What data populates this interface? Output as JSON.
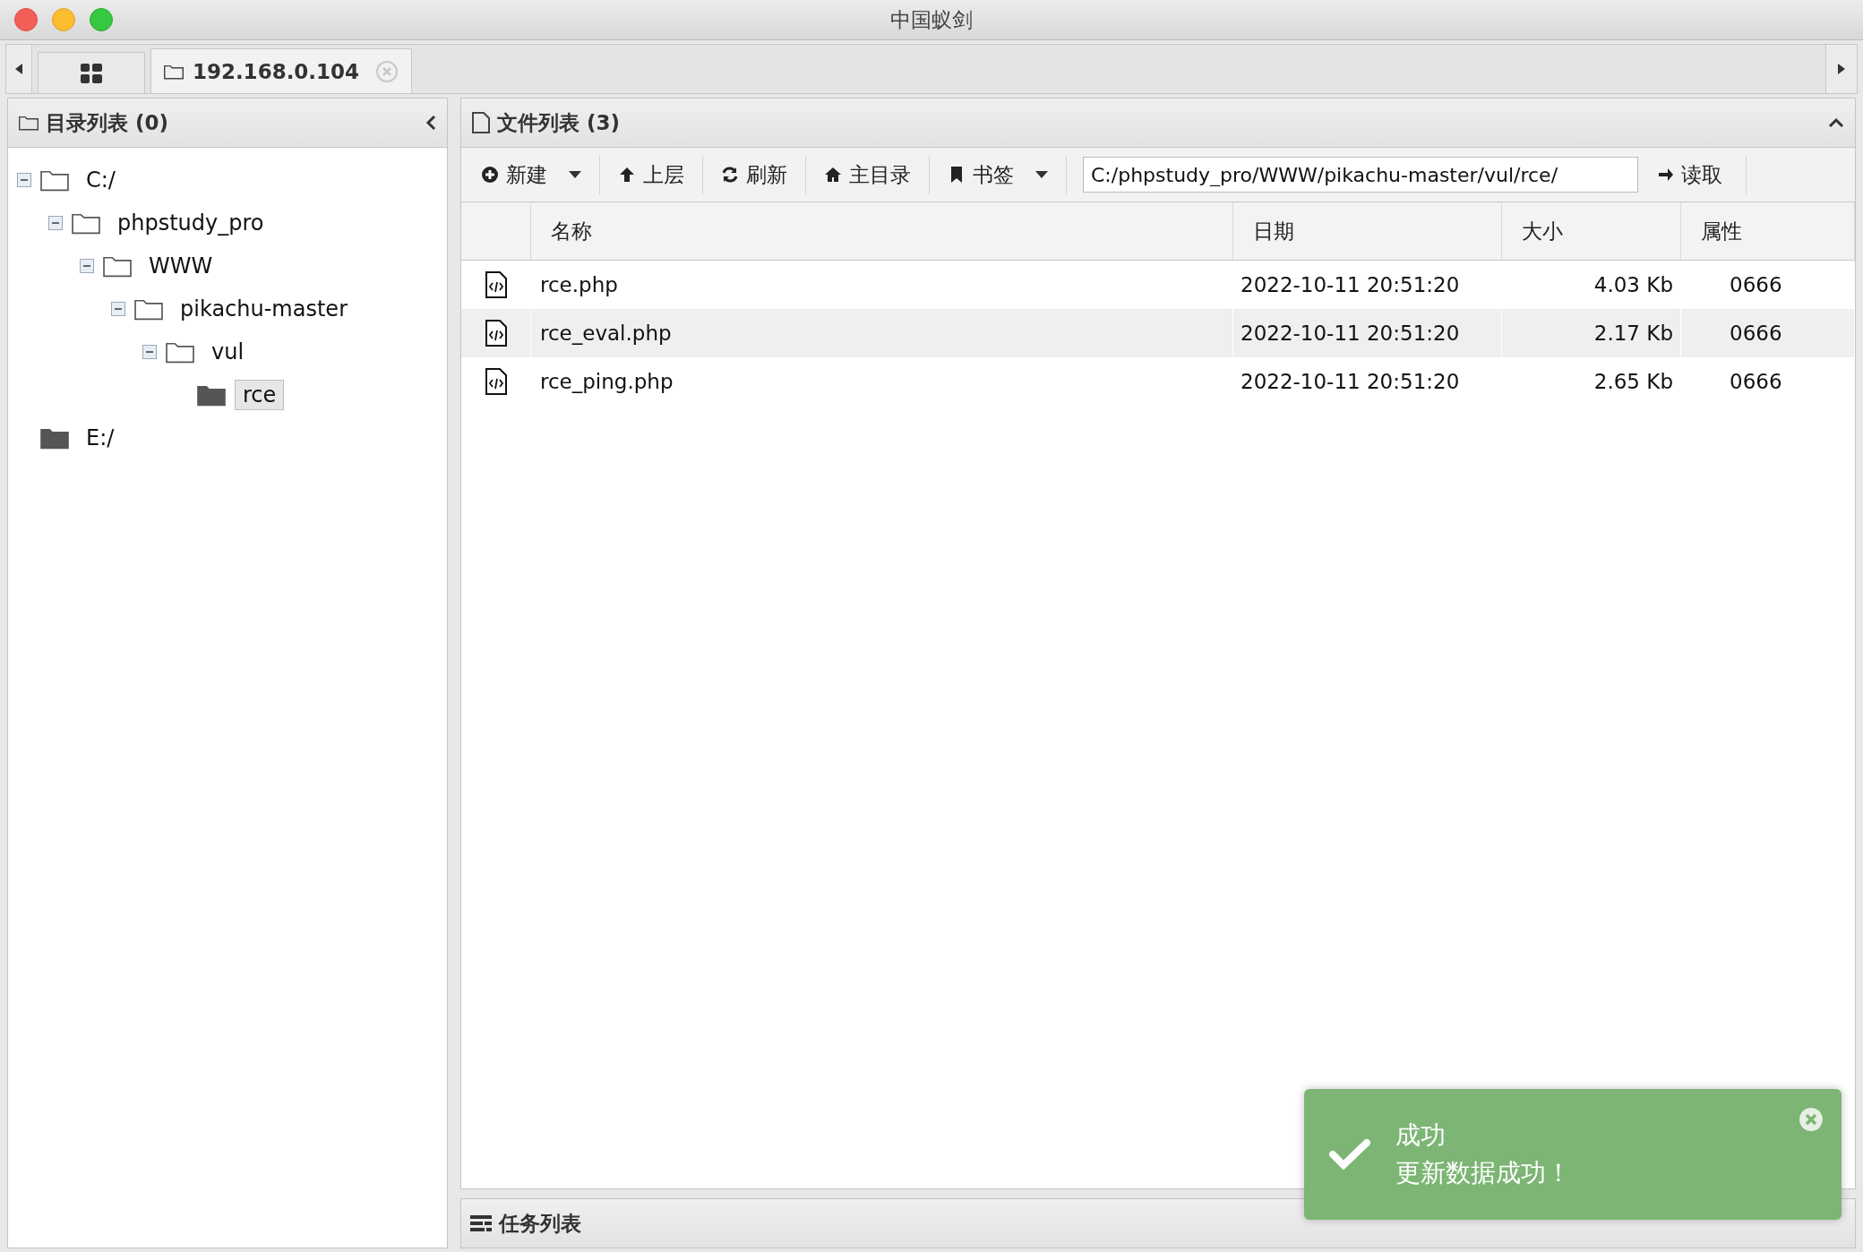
{
  "window": {
    "title": "中国蚁剑"
  },
  "tabs": [
    {
      "kind": "home",
      "selected": false
    },
    {
      "kind": "host",
      "label": "192.168.0.104",
      "selected": true
    }
  ],
  "directory_panel": {
    "title": "目录列表 (0)",
    "tree": [
      {
        "label": "C:/",
        "expanded": true,
        "selected": false,
        "children": [
          {
            "label": "phpstudy_pro",
            "expanded": true,
            "selected": false,
            "children": [
              {
                "label": "WWW",
                "expanded": true,
                "selected": false,
                "children": [
                  {
                    "label": "pikachu-master",
                    "expanded": true,
                    "selected": false,
                    "children": [
                      {
                        "label": "vul",
                        "expanded": true,
                        "selected": false,
                        "children": [
                          {
                            "label": "rce",
                            "expanded": false,
                            "selected": true
                          }
                        ]
                      }
                    ]
                  }
                ]
              }
            ]
          }
        ]
      },
      {
        "label": "E:/",
        "expanded": false,
        "selected": false
      }
    ]
  },
  "file_panel": {
    "title": "文件列表 (3)",
    "toolbar": [
      {
        "kind": "new",
        "label": "新建",
        "dropdown": true
      },
      {
        "kind": "up",
        "label": "上层",
        "dropdown": false
      },
      {
        "kind": "refresh",
        "label": "刷新",
        "dropdown": false
      },
      {
        "kind": "home",
        "label": "主目录",
        "dropdown": false
      },
      {
        "kind": "bookmark",
        "label": "书签",
        "dropdown": true
      }
    ],
    "path": "C:/phpstudy_pro/WWW/pikachu-master/vul/rce/",
    "read_button": "读取",
    "columns": [
      "名称",
      "日期",
      "大小",
      "属性"
    ],
    "rows": [
      {
        "name": "rce.php",
        "date": "2022-10-11 20:51:20",
        "size": "4.03 Kb",
        "mode": "0666",
        "selected": false
      },
      {
        "name": "rce_eval.php",
        "date": "2022-10-11 20:51:20",
        "size": "2.17 Kb",
        "mode": "0666",
        "selected": true
      },
      {
        "name": "rce_ping.php",
        "date": "2022-10-11 20:51:20",
        "size": "2.65 Kb",
        "mode": "0666",
        "selected": false
      }
    ]
  },
  "task_panel": {
    "title": "任务列表"
  },
  "toast": {
    "title": "成功",
    "message": "更新数据成功！"
  }
}
